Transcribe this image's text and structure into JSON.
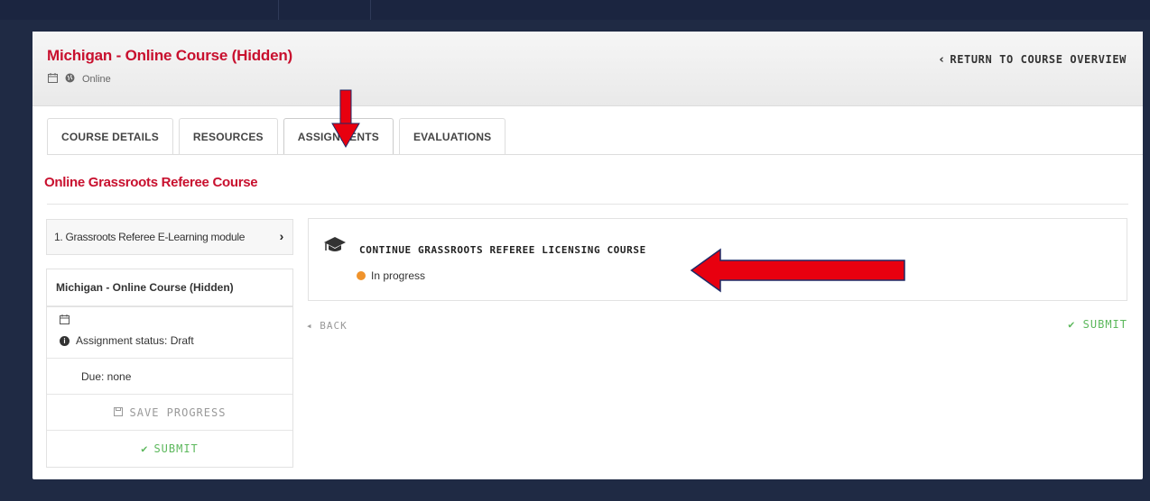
{
  "header": {
    "course_title": "Michigan - Online Course (Hidden)",
    "mode": "Online",
    "return_label": "RETURN TO COURSE OVERVIEW"
  },
  "tabs": [
    {
      "label": "COURSE DETAILS"
    },
    {
      "label": "RESOURCES"
    },
    {
      "label": "ASSIGNMENTS",
      "active": true
    },
    {
      "label": "EVALUATIONS"
    }
  ],
  "section_title": "Online Grassroots Referee Course",
  "left_panel": {
    "module_label": "1. Grassroots Referee E-Learning module",
    "course_name": "Michigan - Online Course (Hidden)",
    "assignment_status": "Assignment status: Draft",
    "due": "Due: none",
    "save_label": "SAVE PROGRESS",
    "submit_label": "SUBMIT"
  },
  "assignment": {
    "link_label": "CONTINUE GRASSROOTS REFEREE LICENSING COURSE",
    "status": "In progress"
  },
  "footer": {
    "back_label": "BACK",
    "submit_label": "SUBMIT"
  },
  "colors": {
    "accent_red": "#c8102e",
    "success_green": "#5cb85c",
    "progress_orange": "#f0932b",
    "page_bg": "#1f2a44"
  }
}
